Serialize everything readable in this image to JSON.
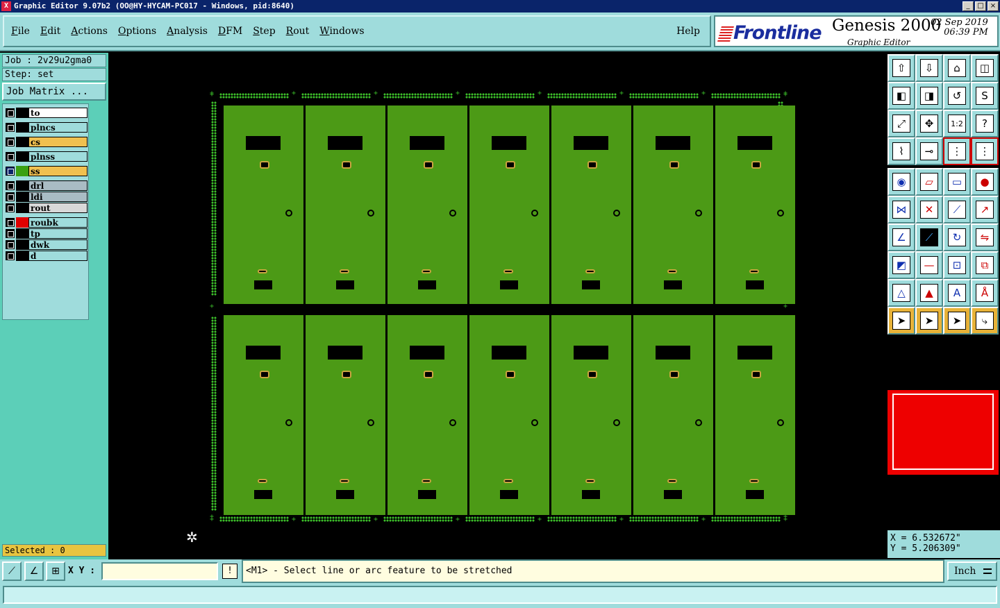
{
  "window": {
    "title": "Graphic Editor 9.07b2 (OO@HY-HYCAM-PC017 - Windows, pid:8640)",
    "app_icon": "X",
    "controls": [
      "_",
      "□",
      "×"
    ]
  },
  "menu": {
    "items": [
      "File",
      "Edit",
      "Actions",
      "Options",
      "Analysis",
      "DFM",
      "Step",
      "Rout",
      "Windows"
    ],
    "help": "Help"
  },
  "brand": {
    "logo": "Frontline",
    "product": "Genesis 2000",
    "subtitle": "Graphic Editor",
    "date": "02  Sep  2019",
    "time": "06:39  PM"
  },
  "job": {
    "job_label": "Job : 2v29u2gma0",
    "step_label": "Step: set",
    "matrix_button": "Job Matrix ..."
  },
  "layers": [
    {
      "name": "to",
      "swatch": "#000000",
      "bg": "#ffffff"
    },
    {
      "name": "plncs",
      "swatch": "#000000",
      "bg": "#9fdcdc"
    },
    {
      "name": "cs",
      "swatch": "#000000",
      "bg": "#f0c050"
    },
    {
      "name": "plnss",
      "swatch": "#000000",
      "bg": "#9fdcdc"
    },
    {
      "name": "ss",
      "swatch": "#3aa012",
      "bg": "#f0c050",
      "active": true
    },
    {
      "name": "drl",
      "swatch": "#000000",
      "bg": "#a9bcc4"
    },
    {
      "name": "ldi",
      "swatch": "#000000",
      "bg": "#a9bcc4"
    },
    {
      "name": "rout",
      "swatch": "#000000",
      "bg": "#d8d8d8"
    },
    {
      "name": "roubk",
      "swatch": "#e00000",
      "bg": "#9fdcdc"
    },
    {
      "name": "tp",
      "swatch": "#000000",
      "bg": "#9fdcdc"
    },
    {
      "name": "dwk",
      "swatch": "#000000",
      "bg": "#9fdcdc"
    },
    {
      "name": "d",
      "swatch": "#000000",
      "bg": "#9fdcdc"
    }
  ],
  "selected": "Selected : 0",
  "tools": [
    [
      "upload-icon",
      "download-icon",
      "home-icon",
      "split-icon"
    ],
    [
      "zoom-left-icon",
      "zoom-right-icon",
      "undo-icon",
      "redo-icon"
    ],
    [
      "fit-icon",
      "pan-icon",
      "scale-icon",
      "help-icon"
    ],
    [
      "measure-icon",
      "snap-icon",
      "net-icon",
      "net-red-icon"
    ],
    [
      "select-icon",
      "polygon-icon",
      "ruler-icon",
      "pad-icon"
    ],
    [
      "node-icon",
      "cross-icon",
      "line-icon",
      "arc-icon"
    ],
    [
      "angle-icon",
      "stretch-icon",
      "rotate-icon",
      "mirror-icon"
    ],
    [
      "shape-icon",
      "segment-icon",
      "dimension-icon",
      "group-icon"
    ],
    [
      "triangle-icon",
      "triangle2-icon",
      "triangle3-icon",
      "triangle4-icon"
    ],
    [
      "pointer-icon",
      "pointer2-icon",
      "pointer3-icon",
      "pointer4-icon"
    ]
  ],
  "coords": {
    "x": "X = 6.532672\"",
    "y": "Y = 5.206309\""
  },
  "bottom": {
    "xy_label": "X Y :",
    "xy_value": "",
    "pipe": "!",
    "prompt": "<M1> - Select line or arc feature to be stretched",
    "units": "Inch"
  },
  "colors": {
    "board": "#4c9a16",
    "panel_bg": "#9fdcdc",
    "accent": "#e8c440"
  }
}
